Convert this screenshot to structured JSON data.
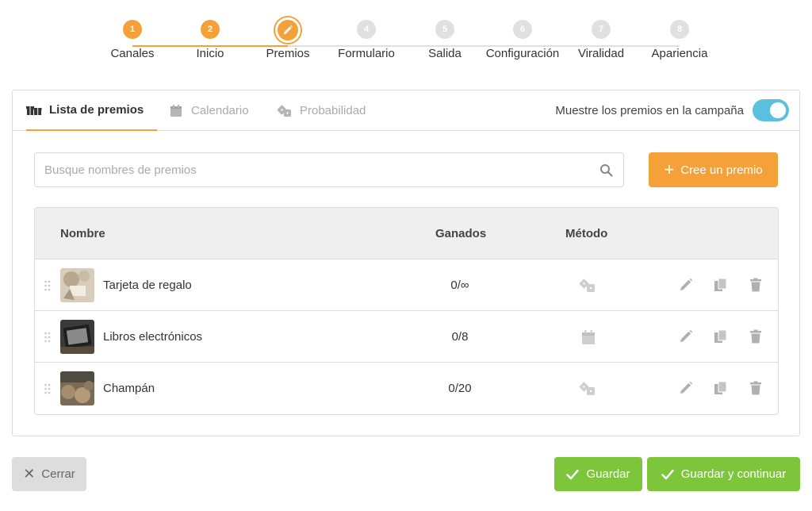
{
  "stepper": {
    "steps": [
      {
        "number": "1",
        "label": "Canales",
        "state": "done"
      },
      {
        "number": "2",
        "label": "Inicio",
        "state": "done"
      },
      {
        "number": "3",
        "label": "Premios",
        "state": "active"
      },
      {
        "number": "4",
        "label": "Formulario",
        "state": "pending"
      },
      {
        "number": "5",
        "label": "Salida",
        "state": "pending"
      },
      {
        "number": "6",
        "label": "Configuración",
        "state": "pending"
      },
      {
        "number": "7",
        "label": "Viralidad",
        "state": "pending"
      },
      {
        "number": "8",
        "label": "Apariencia",
        "state": "pending"
      }
    ],
    "active_icon": "pencil-icon"
  },
  "tabs": {
    "items": [
      {
        "label": "Lista de premios",
        "icon": "gifts-icon",
        "active": true
      },
      {
        "label": "Calendario",
        "icon": "calendar-icon",
        "active": false
      },
      {
        "label": "Probabilidad",
        "icon": "dice-icon",
        "active": false
      }
    ],
    "toggle_label": "Muestre los premios en la campaña",
    "toggle_on": true
  },
  "search": {
    "placeholder": "Busque nombres de premios",
    "value": "",
    "icon": "search-icon"
  },
  "create_button": {
    "label": "Cree un premio",
    "icon": "plus-icon"
  },
  "table": {
    "headers": {
      "name": "Nombre",
      "won": "Ganados",
      "method": "Método"
    },
    "rows": [
      {
        "name": "Tarjeta de regalo",
        "won": "0/∞",
        "method_icon": "dice-icon"
      },
      {
        "name": "Libros electrónicos",
        "won": "0/8",
        "method_icon": "calendar-icon"
      },
      {
        "name": "Champán",
        "won": "0/20",
        "method_icon": "dice-icon"
      }
    ],
    "row_actions": [
      "edit-icon",
      "duplicate-icon",
      "trash-icon"
    ]
  },
  "footer": {
    "close_label": "Cerrar",
    "save_label": "Guardar",
    "save_continue_label": "Guardar y continuar"
  },
  "colors": {
    "accent": "#f5a13a",
    "success": "#7dc63b",
    "toggle": "#5bc0de",
    "inactive_step": "#e0e0e0"
  }
}
